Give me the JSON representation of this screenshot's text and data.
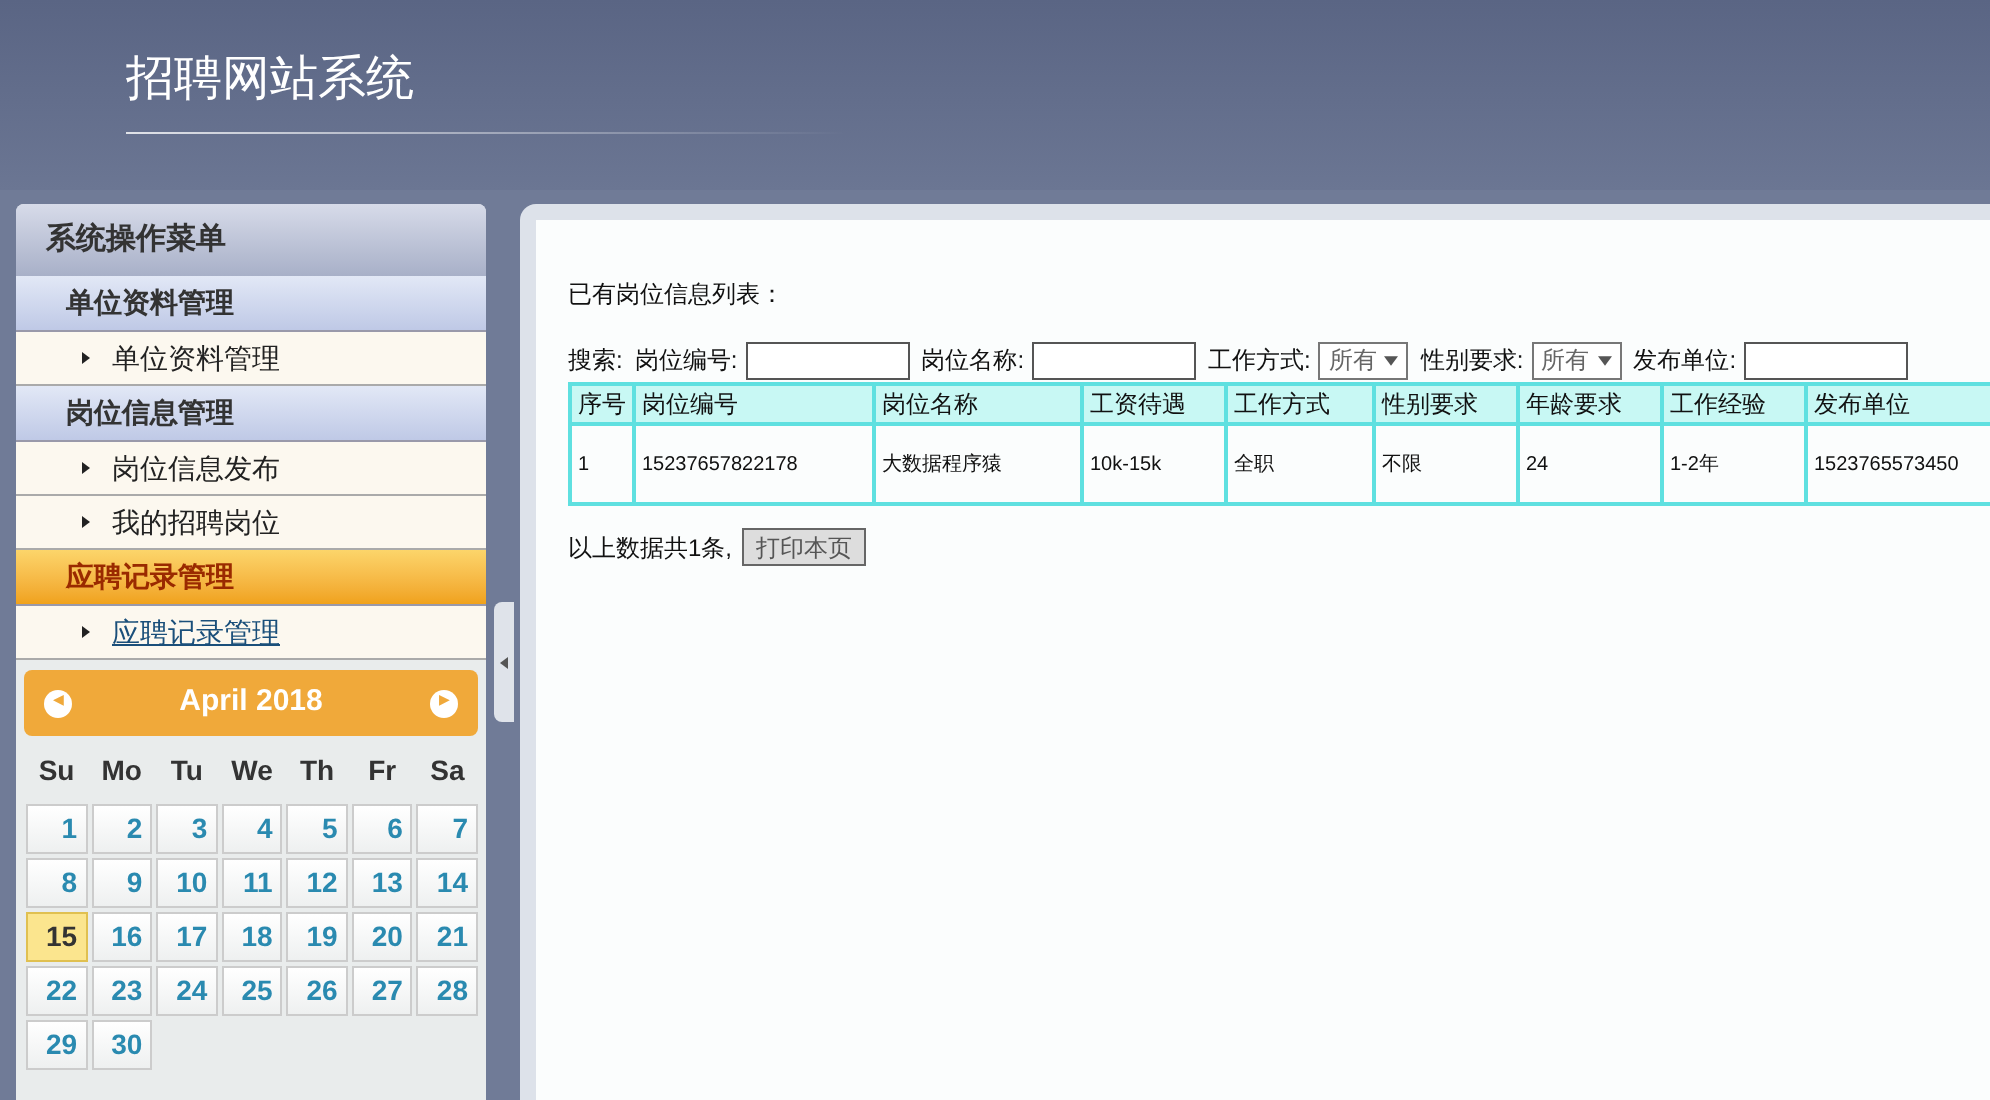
{
  "header": {
    "title": "招聘网站系统"
  },
  "sidebar": {
    "title": "系统操作菜单",
    "groups": [
      {
        "label": "单位资料管理",
        "selected": false,
        "items": [
          {
            "label": "单位资料管理",
            "selected": false
          }
        ]
      },
      {
        "label": "岗位信息管理",
        "selected": false,
        "items": [
          {
            "label": "岗位信息发布",
            "selected": false
          },
          {
            "label": "我的招聘岗位",
            "selected": false
          }
        ]
      },
      {
        "label": "应聘记录管理",
        "selected": true,
        "items": [
          {
            "label": "应聘记录管理",
            "selected": true
          }
        ]
      }
    ]
  },
  "calendar": {
    "prev": "◀",
    "next": "▶",
    "month": "April 2018",
    "weekdays": [
      "Su",
      "Mo",
      "Tu",
      "We",
      "Th",
      "Fr",
      "Sa"
    ],
    "days": [
      {
        "label": "1",
        "selected": false
      },
      {
        "label": "2",
        "selected": false
      },
      {
        "label": "3",
        "selected": false
      },
      {
        "label": "4",
        "selected": false
      },
      {
        "label": "5",
        "selected": false
      },
      {
        "label": "6",
        "selected": false
      },
      {
        "label": "7",
        "selected": false
      },
      {
        "label": "8",
        "selected": false
      },
      {
        "label": "9",
        "selected": false
      },
      {
        "label": "10",
        "selected": false
      },
      {
        "label": "11",
        "selected": false
      },
      {
        "label": "12",
        "selected": false
      },
      {
        "label": "13",
        "selected": false
      },
      {
        "label": "14",
        "selected": false
      },
      {
        "label": "15",
        "selected": true
      },
      {
        "label": "16",
        "selected": false
      },
      {
        "label": "17",
        "selected": false
      },
      {
        "label": "18",
        "selected": false
      },
      {
        "label": "19",
        "selected": false
      },
      {
        "label": "20",
        "selected": false
      },
      {
        "label": "21",
        "selected": false
      },
      {
        "label": "22",
        "selected": false
      },
      {
        "label": "23",
        "selected": false
      },
      {
        "label": "24",
        "selected": false
      },
      {
        "label": "25",
        "selected": false
      },
      {
        "label": "26",
        "selected": false
      },
      {
        "label": "27",
        "selected": false
      },
      {
        "label": "28",
        "selected": false
      },
      {
        "label": "29",
        "selected": false
      },
      {
        "label": "30",
        "selected": false
      }
    ]
  },
  "main": {
    "heading": "已有岗位信息列表：",
    "search_label": "搜索:",
    "filters": [
      {
        "kind": "text",
        "label": "岗位编号:"
      },
      {
        "kind": "text",
        "label": "岗位名称:"
      },
      {
        "kind": "select",
        "label": "工作方式:",
        "value": "所有"
      },
      {
        "kind": "select",
        "label": "性别要求:",
        "value": "所有"
      },
      {
        "kind": "text",
        "label": "发布单位:"
      }
    ],
    "table": {
      "columns": [
        "序号",
        "岗位编号",
        "岗位名称",
        "工资待遇",
        "工作方式",
        "性别要求",
        "年龄要求",
        "工作经验",
        "发布单位"
      ],
      "rows": [
        [
          "1",
          "15237657822178",
          "大数据程序猿",
          "10k-15k",
          "全职",
          "不限",
          "24",
          "1-2年",
          "1523765573450"
        ]
      ]
    },
    "summary": "以上数据共1条,",
    "print_button": "打印本页"
  }
}
